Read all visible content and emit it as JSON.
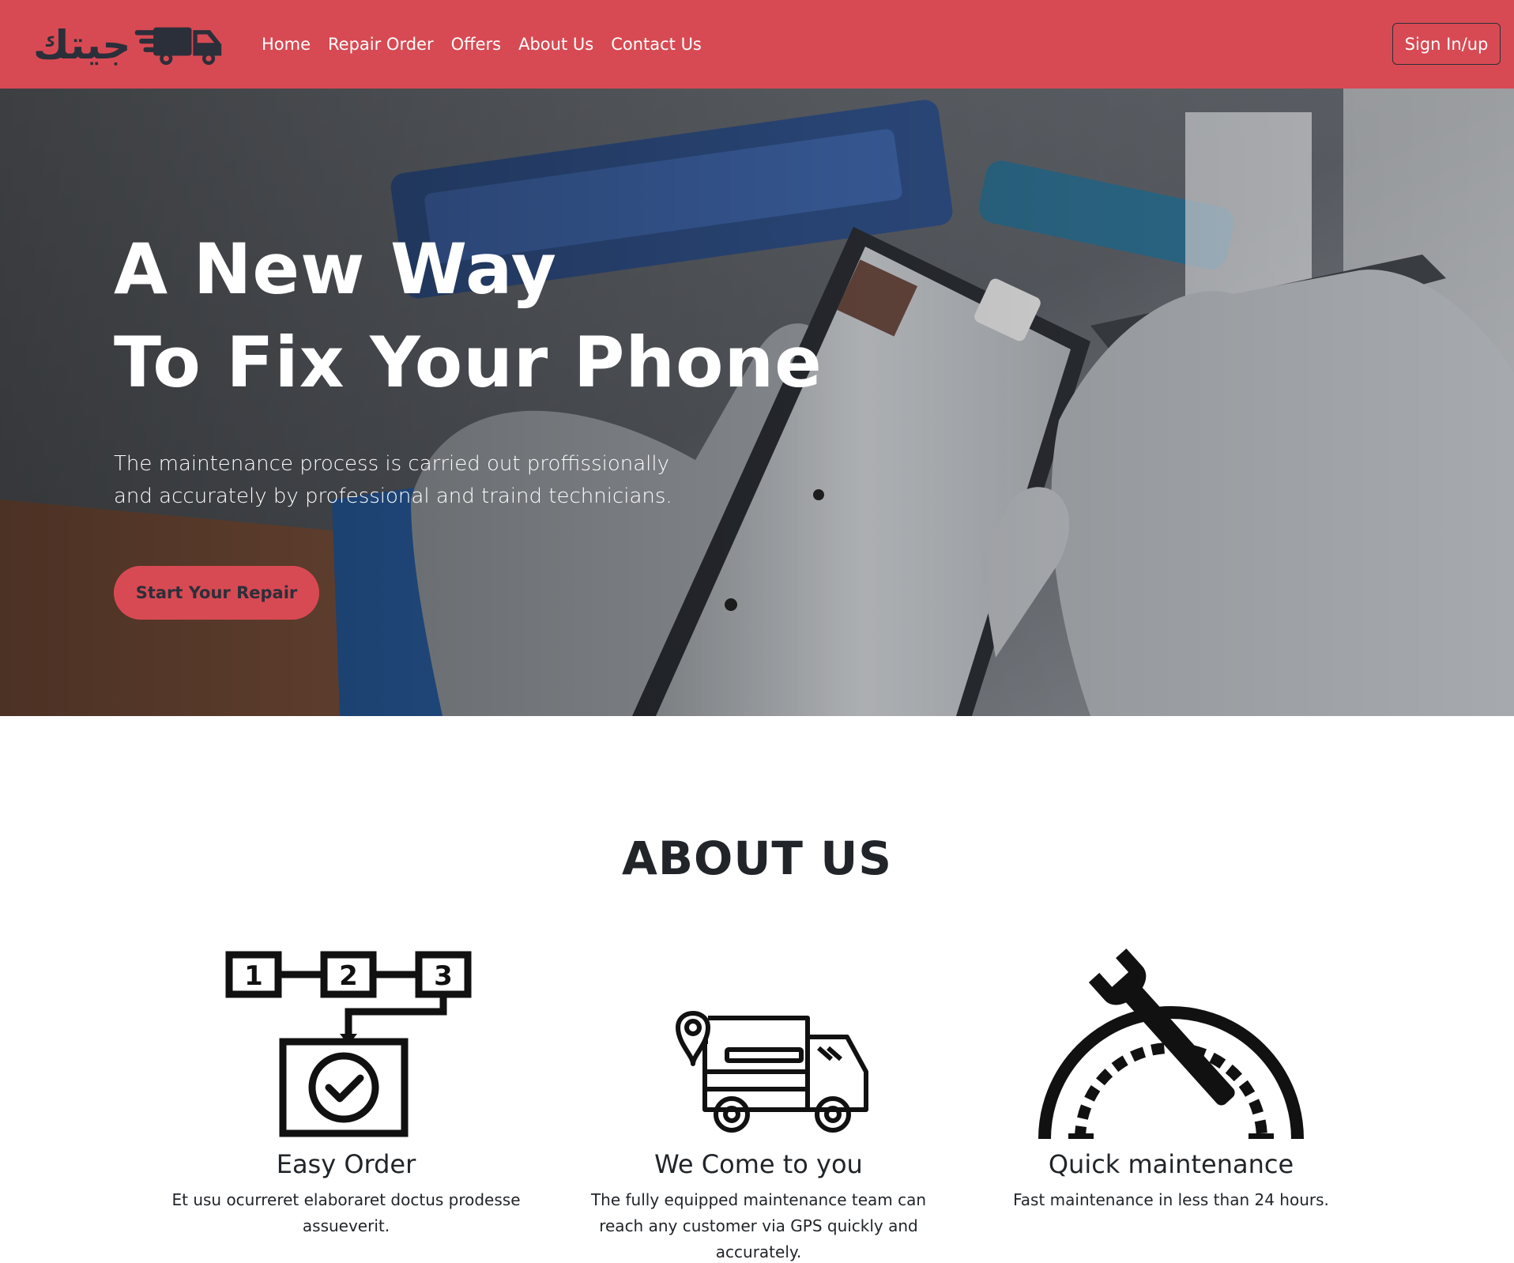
{
  "brand": {
    "logo_text": "جيتك",
    "colors": {
      "primary": "#d84a53",
      "dark": "#2b2f3a"
    }
  },
  "nav": {
    "items": [
      "Home",
      "Repair Order",
      "Offers",
      "About Us",
      "Contact Us"
    ],
    "signin_label": "Sign In/up"
  },
  "hero": {
    "title_line1": "A New Way",
    "title_line2": "To Fix Your Phone",
    "text": "The maintenance process is carried out proffissionally and accurately by professional and traind technicians.",
    "button_label": "Start Your Repair"
  },
  "about": {
    "title": "ABOUT US",
    "features": [
      {
        "icon": "steps-123-icon",
        "title": "Easy Order",
        "text": "Et usu ocurreret elaboraret doctus prodesse assueverit."
      },
      {
        "icon": "delivery-truck-icon",
        "title": "We Come to you",
        "text": "The fully equipped maintenance team can reach any customer via GPS quickly and accurately."
      },
      {
        "icon": "speedometer-wrench-icon",
        "title": "Quick maintenance",
        "text": "Fast maintenance in less than 24 hours."
      }
    ]
  }
}
